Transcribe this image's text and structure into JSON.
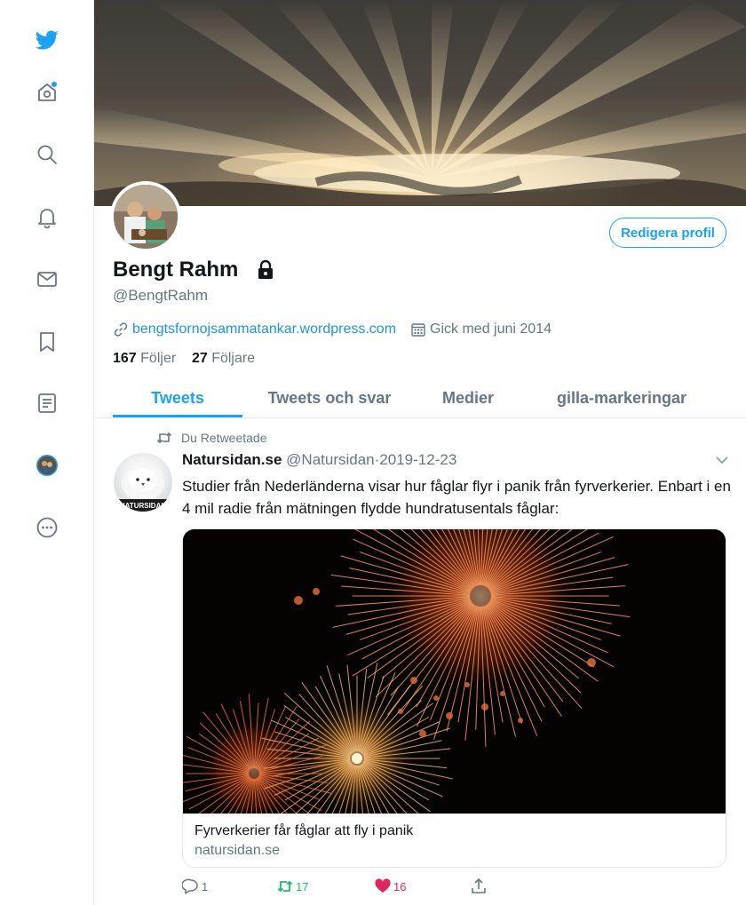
{
  "nav": {
    "items": [
      {
        "icon": "twitter-bird-icon"
      },
      {
        "icon": "home-icon"
      },
      {
        "icon": "search-icon"
      },
      {
        "icon": "notifications-bell-icon"
      },
      {
        "icon": "messages-envelope-icon"
      },
      {
        "icon": "bookmark-icon"
      },
      {
        "icon": "lists-icon"
      },
      {
        "icon": "profile-avatar-icon"
      },
      {
        "icon": "more-icon"
      }
    ],
    "accent_color": "#1da1f2"
  },
  "profile": {
    "display_name": "Bengt Rahm",
    "handle": "@BengtRahm",
    "edit_button": "Redigera profil",
    "website": "bengtsfornojsammatankar.wordpress.com",
    "joined": "Gick med juni 2014",
    "following_count": "167",
    "following_label": "Följer",
    "followers_count": "27",
    "followers_label": "Följare",
    "protected_icon": "lock-icon"
  },
  "tabs": [
    {
      "label": "Tweets",
      "active": true
    },
    {
      "label": "Tweets och svar",
      "active": false
    },
    {
      "label": "Medier",
      "active": false
    },
    {
      "label": "gilla-markeringar",
      "active": false
    }
  ],
  "tweet": {
    "retweet_context": "Du Retweetade",
    "author_name": "Natursidan.se",
    "author_handle": "@Natursidan",
    "separator": "·",
    "date": "2019-12-23",
    "text": "Studier från Nederländerna visar hur fåglar flyr i panik från fyrverkerier. Enbart i en 4 mil radie från mätningen flydde hundratusentals fåglar:",
    "card": {
      "title": "Fyrverkerier får fåglar att fly i panik",
      "domain": "natursidan.se"
    },
    "reply_count": "1",
    "retweet_count": "17",
    "like_count": "16",
    "retweet_color": "#17bf63",
    "like_color": "#e0245e"
  }
}
